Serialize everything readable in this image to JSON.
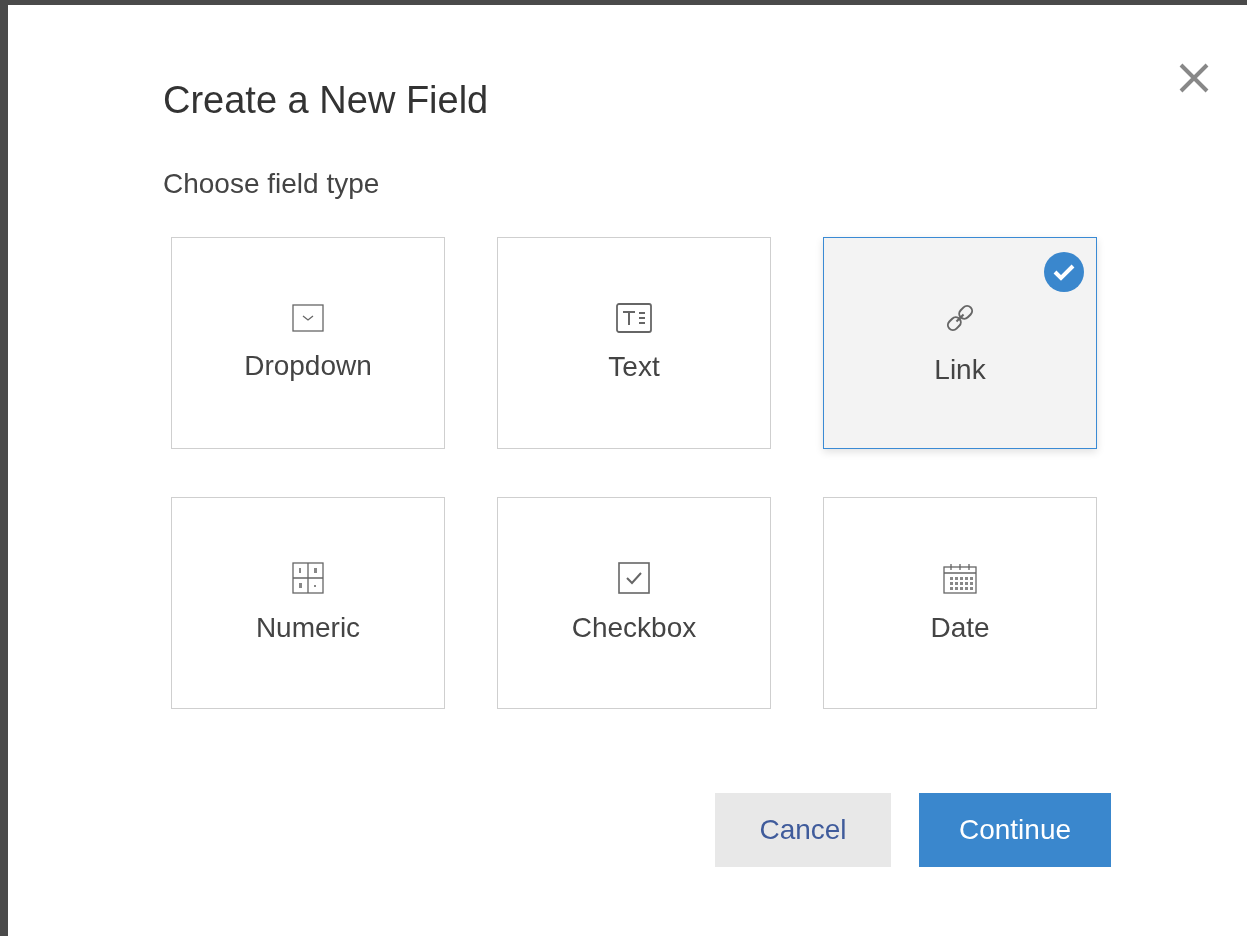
{
  "dialog": {
    "title": "Create a New Field",
    "subtitle": "Choose field type",
    "options": [
      {
        "kind": "dropdown",
        "label": "Dropdown",
        "selected": false
      },
      {
        "kind": "text",
        "label": "Text",
        "selected": false
      },
      {
        "kind": "link",
        "label": "Link",
        "selected": true
      },
      {
        "kind": "numeric",
        "label": "Numeric",
        "selected": false
      },
      {
        "kind": "checkbox",
        "label": "Checkbox",
        "selected": false
      },
      {
        "kind": "date",
        "label": "Date",
        "selected": false
      }
    ],
    "buttons": [
      {
        "kind": "secondary",
        "label": "Cancel"
      },
      {
        "kind": "primary",
        "label": "Continue"
      }
    ]
  }
}
